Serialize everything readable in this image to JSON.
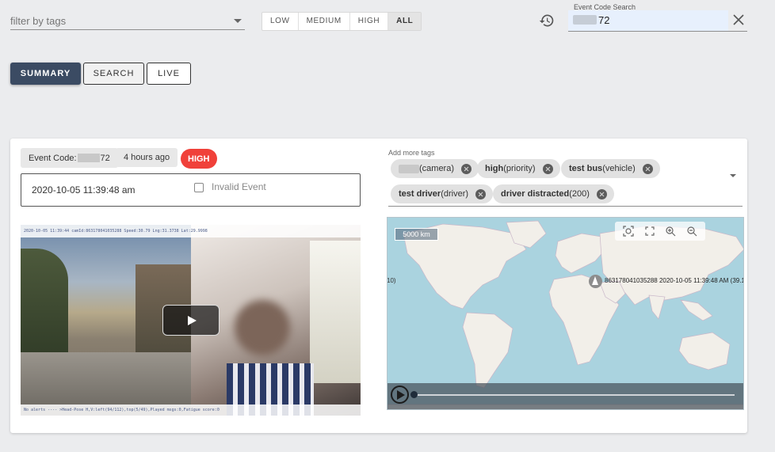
{
  "filter": {
    "placeholder": "filter by tags"
  },
  "priority": {
    "options": [
      "LOW",
      "MEDIUM",
      "HIGH",
      "ALL"
    ],
    "selected": "ALL"
  },
  "event_code_search": {
    "label": "Event Code Search",
    "value_visible": "72"
  },
  "modes": {
    "summary": "SUMMARY",
    "search": "SEARCH",
    "live": "LIVE",
    "active": "SUMMARY"
  },
  "event": {
    "code_label": "Event Code:",
    "code_suffix": "72",
    "time_ago": "4 hours ago",
    "priority": "HIGH",
    "timestamp": "2020-10-05 11:39:48 am",
    "invalid_label": "Invalid Event",
    "invalid_checked": false
  },
  "tags": {
    "label": "Add more tags",
    "items": [
      {
        "bold": "",
        "rest": "(camera)",
        "redacted": true
      },
      {
        "bold": "high",
        "rest": "(priority)",
        "redacted": false
      },
      {
        "bold": "test bus",
        "rest": "(vehicle)",
        "redacted": false
      },
      {
        "bold": "test driver",
        "rest": "(driver)",
        "redacted": false
      },
      {
        "bold": "driver distracted",
        "rest": "(200)",
        "redacted": false
      }
    ]
  },
  "video": {
    "overlay_top": "2020-10-05 11:39:44  camId:863178041035288  Speed:30.79  Lng:31.3738  Lat:29.9998",
    "overlay_bottom": "No alerts ---- >Head-Pose H,V:left(94/112),top(5/49),Played msgs:0,Fatigue score:0"
  },
  "map": {
    "scale": "5000 km",
    "side_label": "10)",
    "marker_label": "863178041035288 2020-10-05 11:39:48 AM (39.1",
    "colors": {
      "water": "#aad3df",
      "land": "#f2efe9"
    }
  },
  "colors": {
    "primary": "#3b4b63",
    "high": "#f0413a"
  }
}
